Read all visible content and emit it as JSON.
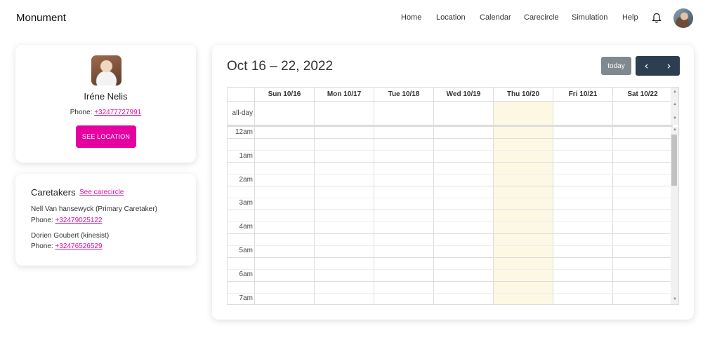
{
  "app": {
    "brand": "Monument"
  },
  "nav": {
    "items": [
      "Home",
      "Location",
      "Calendar",
      "Carecircle",
      "Simulation",
      "Help"
    ]
  },
  "icons": {
    "bell": "bell-icon",
    "prev": "chevron-left-icon",
    "next": "chevron-right-icon"
  },
  "profile": {
    "name": "Iréne Nelis",
    "phone_label": "Phone:",
    "phone": "+32477727991",
    "button": "SEE LOCATION"
  },
  "caretakers": {
    "title": "Caretakers",
    "link": "See carecircle",
    "people": [
      {
        "name": "Nell Van hansewyck (Primary Caretaker)",
        "phone_label": "Phone:",
        "phone": "+32479025122"
      },
      {
        "name": "Dorien Goubert (kinesist)",
        "phone_label": "Phone:",
        "phone": "+32476526529"
      }
    ]
  },
  "calendar": {
    "range": "Oct 16 – 22, 2022",
    "today_label": "today",
    "days": [
      "Sun 10/16",
      "Mon 10/17",
      "Tue 10/18",
      "Wed 10/19",
      "Thu 10/20",
      "Fri 10/21",
      "Sat 10/22"
    ],
    "today_day": "Thu 10/20",
    "allday_label": "all-day",
    "times": [
      "12am",
      "1am",
      "2am",
      "3am",
      "4am",
      "5am",
      "6am",
      "7am"
    ]
  },
  "colors": {
    "accent": "#e600a0",
    "link": "#e8119b",
    "nav_dark": "#2c3e50",
    "today_highlight": "#fcf8e3"
  }
}
